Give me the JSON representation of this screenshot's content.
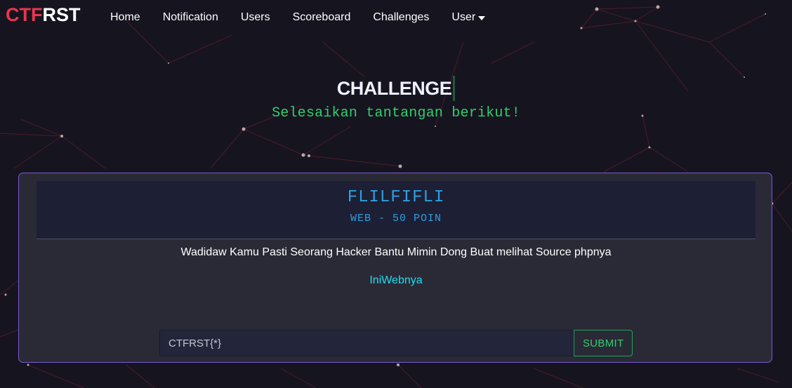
{
  "brand": {
    "part1": "CTF",
    "part2": "RST"
  },
  "nav": {
    "items": [
      {
        "label": "Home"
      },
      {
        "label": "Notification"
      },
      {
        "label": "Users"
      },
      {
        "label": "Scoreboard"
      },
      {
        "label": "Challenges"
      },
      {
        "label": "User",
        "has_dropdown": true
      }
    ]
  },
  "hero": {
    "title": "CHALLENGE",
    "subtitle": "Selesaikan tantangan berikut!"
  },
  "challenge": {
    "name": "FLILFIFLI",
    "category_line": "WEB - 50 POIN",
    "description": "Wadidaw Kamu Pasti Seorang Hacker Bantu Mimin Dong Buat melihat Source phpnya",
    "link_text": "IniWebnya"
  },
  "flag_form": {
    "placeholder": "CTFRST{*}",
    "value": "",
    "submit_label": "SUBMIT"
  },
  "colors": {
    "brand_red": "#e8364f",
    "background": "#16141f",
    "card_border": "#7b5ad6",
    "challenge_blue": "#2d9fe0",
    "link_cyan": "#19e0f2",
    "accent_green": "#2fcf6d"
  },
  "icons": {
    "dropdown": "caret-down-icon"
  }
}
